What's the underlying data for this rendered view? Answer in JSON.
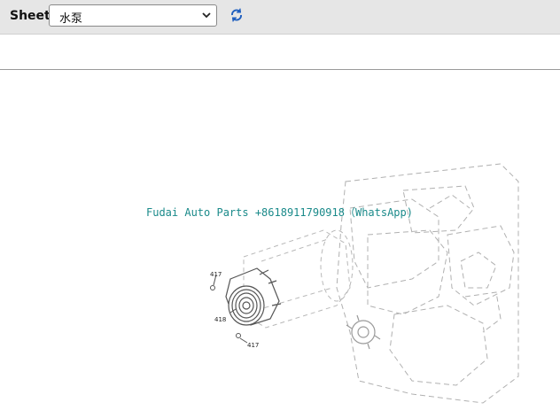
{
  "toolbar": {
    "sheet_label": "Sheet",
    "sheet_value": "水泵",
    "refresh_icon": "refresh-icon",
    "chevron_icon": "chevron-down-icon"
  },
  "diagram": {
    "callouts": [
      "417",
      "418",
      "417"
    ]
  },
  "watermark": {
    "text": "Fudai Auto Parts +8618911790918（WhatsApp)"
  },
  "colors": {
    "toolbar_bg": "#e6e6e6",
    "watermark": "#1a8a8a",
    "icon": "#1f5fbf",
    "line": "#777777"
  }
}
